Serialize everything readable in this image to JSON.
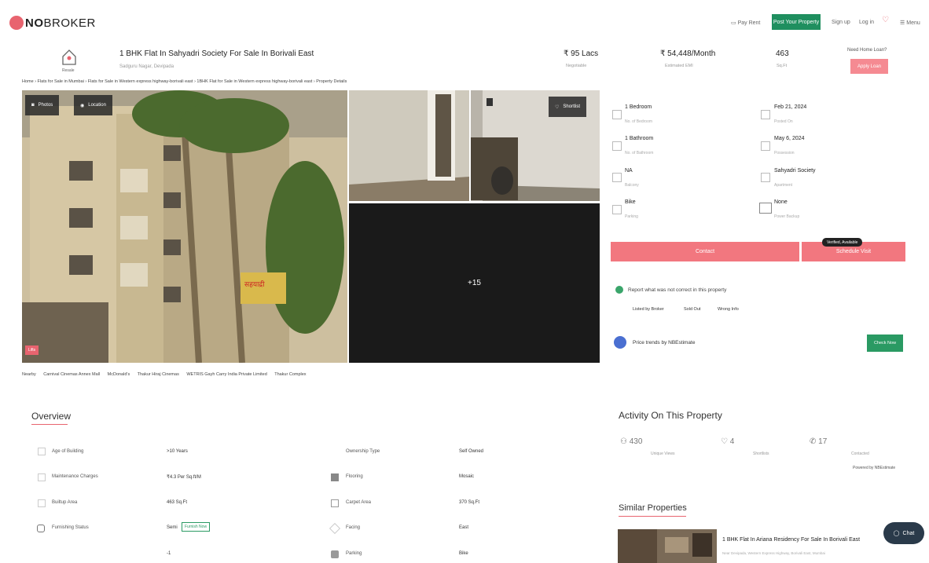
{
  "header": {
    "logo_no": "NO",
    "logo_broker": "BROKER",
    "pay_rent": "Pay Rent",
    "post_property": "Post Your Property",
    "sign_up": "Sign up",
    "log_in": "Log in",
    "menu": "Menu"
  },
  "property": {
    "type_label": "Resale",
    "title": "1 BHK Flat In Sahyadri Society For Sale In Borivali East",
    "subtitle": "Sadguru Nagar, Devipada",
    "price": "₹ 95 Lacs",
    "price_sub": "Negotiable",
    "emi": "₹ 54,448/Month",
    "emi_sub": "Estimated EMI",
    "area": "463",
    "area_sub": "Sq.Ft",
    "home_loan": "Need Home Loan?",
    "apply_loan": "Apply Loan"
  },
  "breadcrumb": "Home  ›  Flats for Sale in Mumbai  ›  Flats for Sale in Western express highway-borivali east  ›  1BHK Flat for Sale in Western express highway-borivali east  ›  Property Details",
  "photos": {
    "photos_btn": "Photos",
    "location_btn": "Location",
    "shortlist_btn": "Shortlist",
    "more_count": "+15",
    "badge": "Lifts",
    "signboard": "सहयाद्री"
  },
  "nearby": {
    "label": "Nearby",
    "items": [
      "Carnival Cinemas Annex Mall",
      "McDonald's",
      "Thakur Hiraj Cinemas",
      "WETRIS Gayh Carry India Private Limited",
      "Thakur Complex"
    ]
  },
  "details": [
    {
      "value": "1 Bedroom",
      "label": "No. of Bedroom"
    },
    {
      "value": "Feb 21, 2024",
      "label": "Posted On"
    },
    {
      "value": "1 Bathroom",
      "label": "No. of Bathroom"
    },
    {
      "value": "May 6, 2024",
      "label": "Possession"
    },
    {
      "value": "NA",
      "label": "Balcony"
    },
    {
      "value": "Sahyadri Society",
      "label": "Apartment"
    },
    {
      "value": "Bike",
      "label": "Parking"
    },
    {
      "value": "None",
      "label": "Power Backup"
    }
  ],
  "actions": {
    "contact": "Contact",
    "schedule": "Schedule Visit",
    "tooltip": "Verified, Available"
  },
  "report": {
    "text": "Report what was not correct in this property",
    "options": [
      "Listed by Broker",
      "Sold Out",
      "Wrong Info"
    ]
  },
  "trend": {
    "text": "Price trends by NBEstimate",
    "button": "Check Now"
  },
  "overview": {
    "title": "Overview",
    "rows": [
      {
        "label": "Age of Building",
        "value": ">10 Years",
        "label2": "Ownership Type",
        "value2": "Self Owned"
      },
      {
        "label": "Maintenance Charges",
        "value": "₹4.3 Per Sq.ft/M",
        "label2": "Flooring",
        "value2": "Mosaic"
      },
      {
        "label": "Builtup Area",
        "value": "463 Sq.Ft",
        "label2": "Carpet Area",
        "value2": "370 Sq.Ft"
      },
      {
        "label": "Furnishing Status",
        "value": "Semi",
        "label2": "Facing",
        "value2": "East"
      },
      {
        "label": "",
        "value": "-1",
        "label2": "Parking",
        "value2": "Bike"
      }
    ],
    "furnish_tag": "Furnish Now"
  },
  "activity": {
    "title": "Activity On This Property",
    "views": "430",
    "views_lbl": "Unique Views",
    "shortlists": "4",
    "shortlists_lbl": "Shortlists",
    "contacted": "17",
    "contacted_lbl": "Contacted",
    "powered": "Powered by NBEstimate"
  },
  "similar": {
    "title": "Similar Properties",
    "item_title": "1 BHK Flat In Ariana Residency For Sale In Borivali East",
    "item_sub": "Near Devipada, Western Express Highway, Borivali East, Mumbai"
  },
  "chat": "Chat"
}
